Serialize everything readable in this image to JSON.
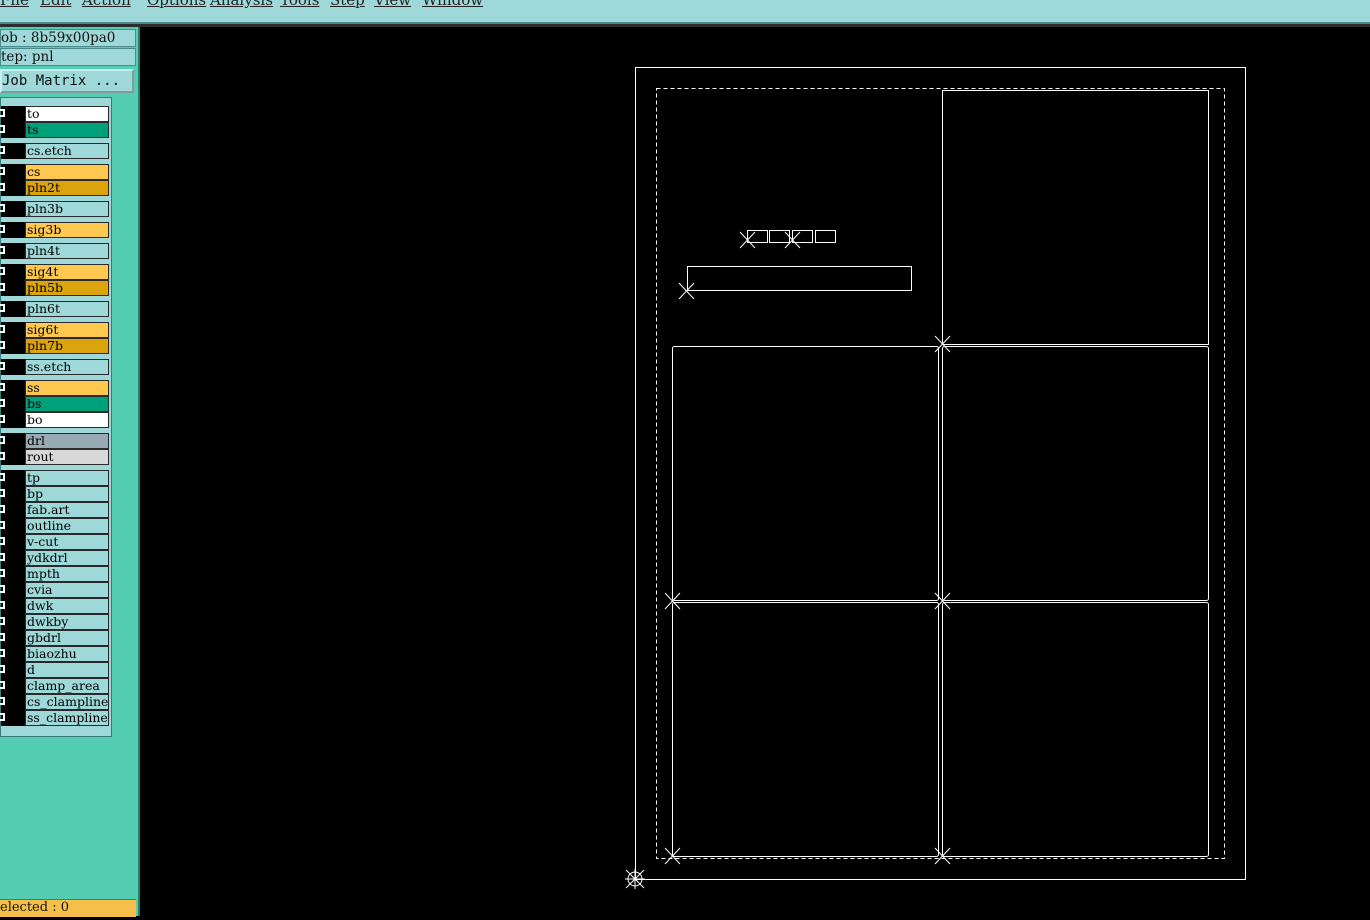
{
  "menu": [
    "File",
    "Edit",
    "Action",
    "Options",
    "Analysis",
    "Tools",
    "Step",
    "View",
    "Window"
  ],
  "job": {
    "job_label": "ob : 8b59x00pa0",
    "step_label": "tep: pnl",
    "matrix_button": "Job Matrix ..."
  },
  "layers": [
    {
      "name": "to",
      "color": "#ffffff"
    },
    {
      "name": "ts",
      "color": "#00a07a"
    },
    {
      "name": "cs.etch",
      "color": "#9ed8d8"
    },
    {
      "name": "cs",
      "color": "#ffc850"
    },
    {
      "name": "pln2t",
      "color": "#dca40c"
    },
    {
      "name": "pln3b",
      "color": "#9ed8d8"
    },
    {
      "name": "sig3b",
      "color": "#ffc850"
    },
    {
      "name": "pln4t",
      "color": "#9ed8d8"
    },
    {
      "name": "sig4t",
      "color": "#ffc850"
    },
    {
      "name": "pln5b",
      "color": "#dca40c"
    },
    {
      "name": "pln6t",
      "color": "#9ed8d8"
    },
    {
      "name": "sig6t",
      "color": "#ffc850"
    },
    {
      "name": "pln7b",
      "color": "#dca40c"
    },
    {
      "name": "ss.etch",
      "color": "#9ed8d8"
    },
    {
      "name": "ss",
      "color": "#ffc850"
    },
    {
      "name": "bs",
      "color": "#00a07a"
    },
    {
      "name": "bo",
      "color": "#ffffff"
    },
    {
      "name": "drl",
      "color": "#9aaab4"
    },
    {
      "name": "rout",
      "color": "#d8d8d8"
    },
    {
      "name": "tp",
      "color": "#9ed8d8"
    },
    {
      "name": "bp",
      "color": "#9ed8d8"
    },
    {
      "name": "fab.art",
      "color": "#9ed8d8"
    },
    {
      "name": "outline",
      "color": "#9ed8d8"
    },
    {
      "name": "v-cut",
      "color": "#9ed8d8"
    },
    {
      "name": "ydkdrl",
      "color": "#9ed8d8"
    },
    {
      "name": "mpth",
      "color": "#9ed8d8"
    },
    {
      "name": "cvia",
      "color": "#9ed8d8"
    },
    {
      "name": "dwk",
      "color": "#9ed8d8"
    },
    {
      "name": "dwkby",
      "color": "#9ed8d8"
    },
    {
      "name": "gbdrl",
      "color": "#9ed8d8"
    },
    {
      "name": "biaozhu",
      "color": "#9ed8d8"
    },
    {
      "name": "d",
      "color": "#9ed8d8"
    },
    {
      "name": "clamp_area",
      "color": "#9ed8d8"
    },
    {
      "name": "cs_clampline",
      "color": "#9ed8d8"
    },
    {
      "name": "ss_clampline",
      "color": "#9ed8d8"
    }
  ],
  "status": {
    "selected": "elected : 0"
  },
  "colors": {
    "panel": "#55cdb2",
    "menubar": "#9ed8d8",
    "canvas": "#000000",
    "drawing": "#ffffff"
  }
}
